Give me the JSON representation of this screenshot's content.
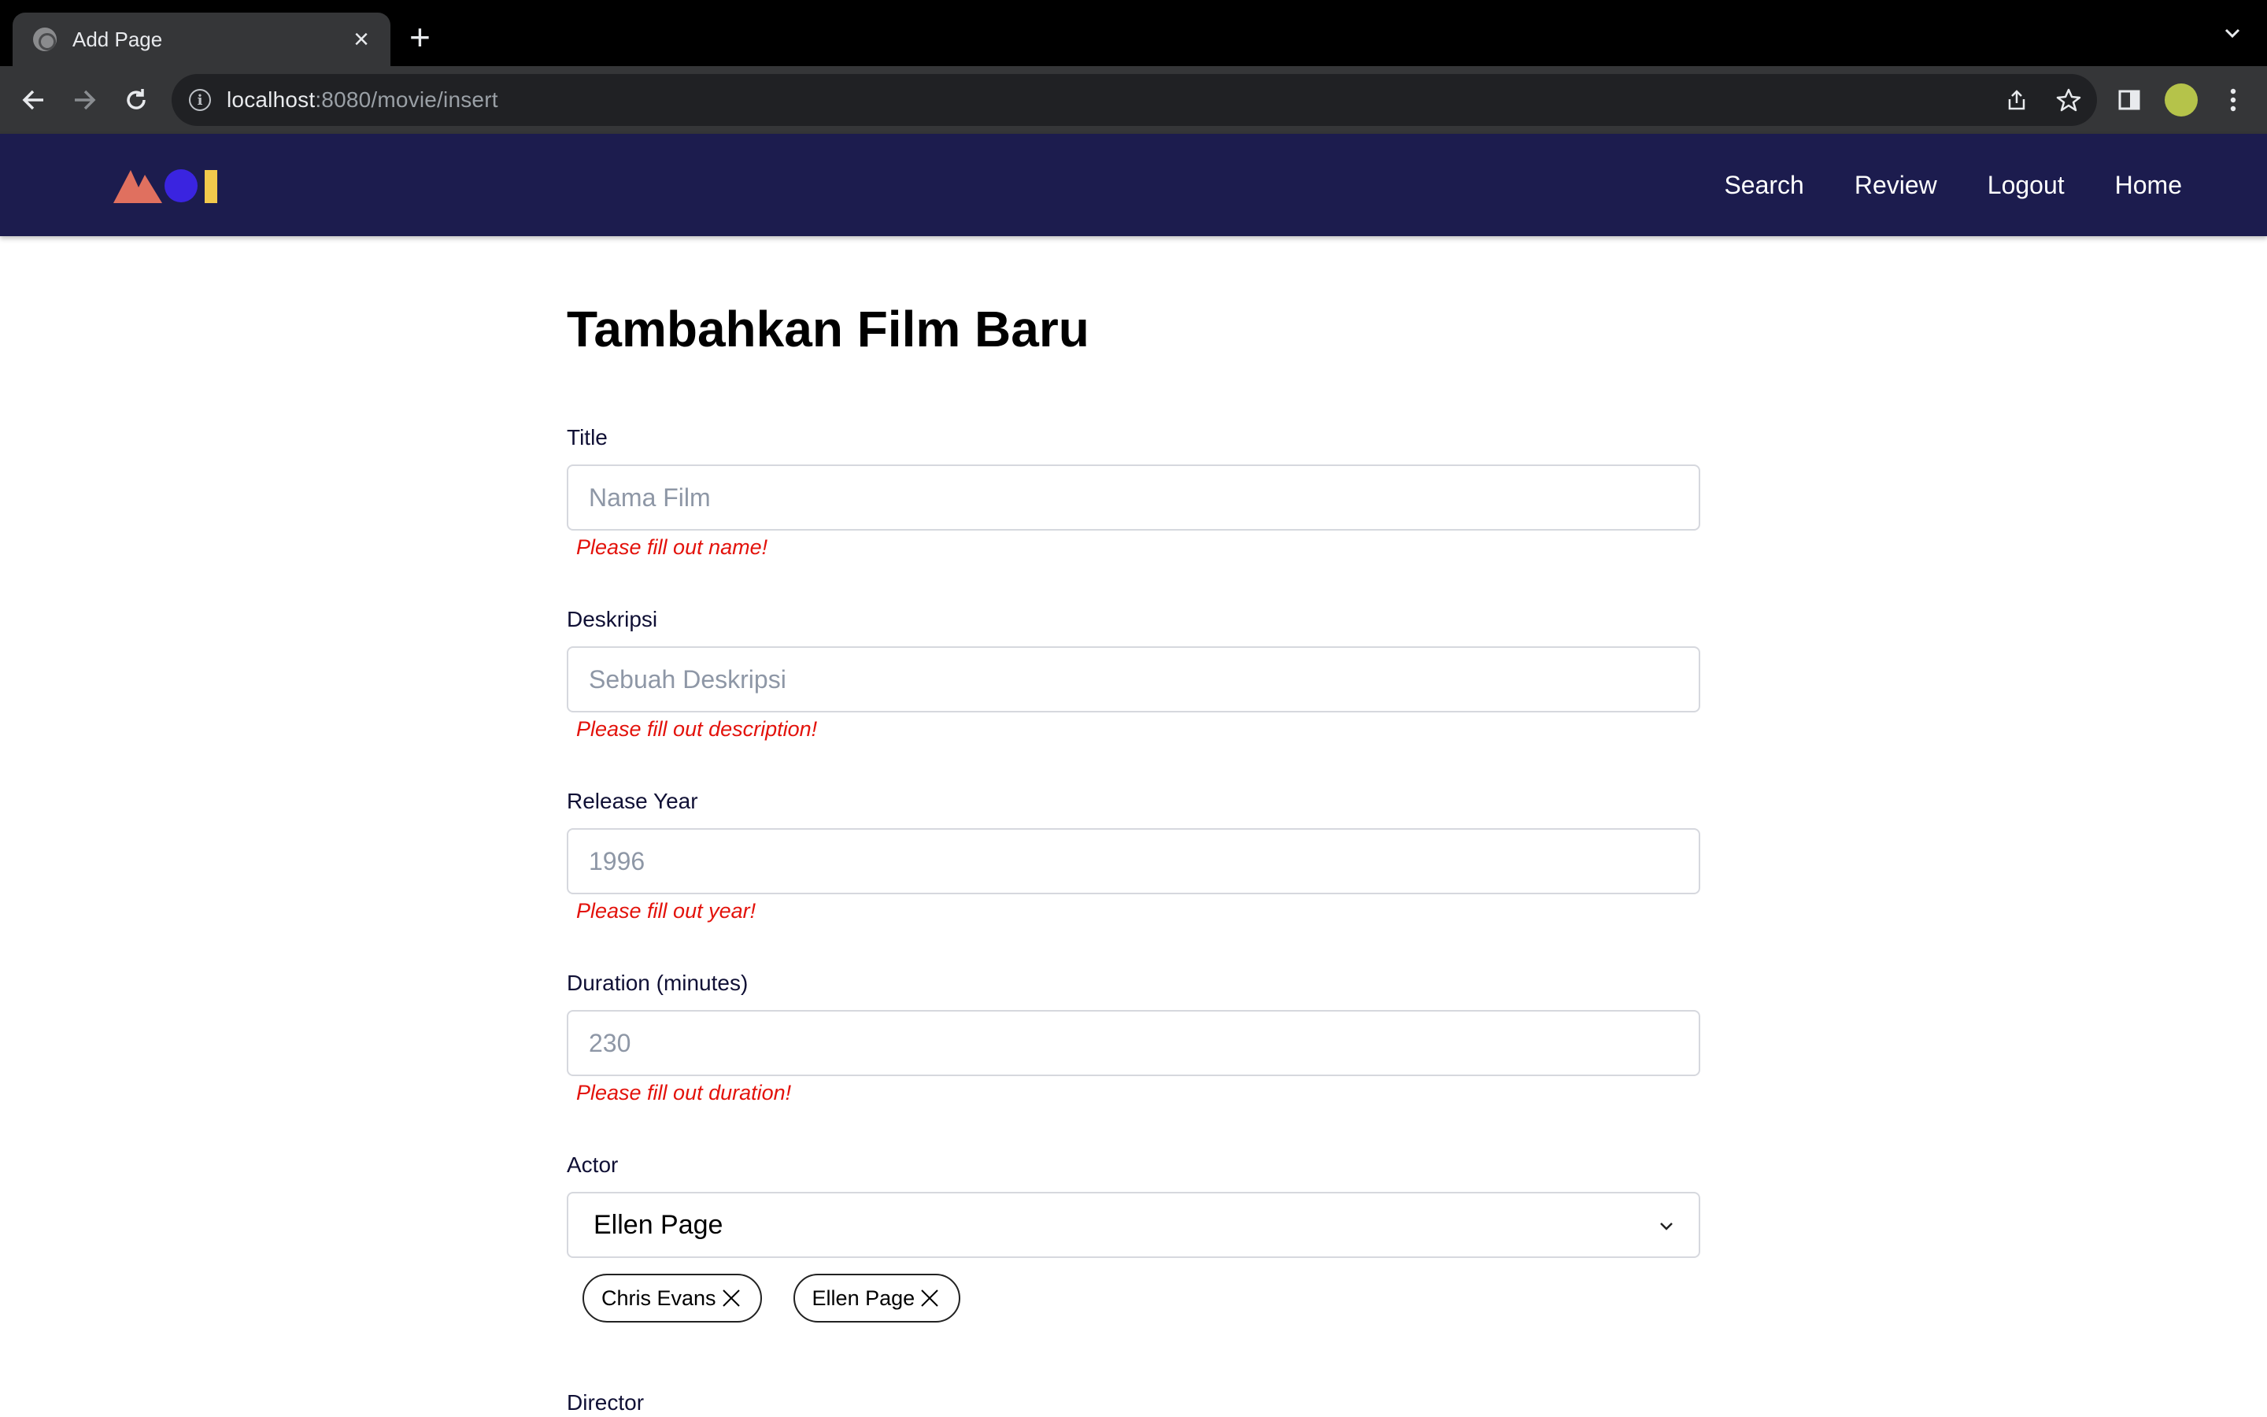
{
  "browser": {
    "tab_title": "Add Page",
    "url_host": "localhost",
    "url_rest": ":8080/movie/insert"
  },
  "nav": {
    "links": [
      "Search",
      "Review",
      "Logout",
      "Home"
    ]
  },
  "colors": {
    "nav_bg": "#1c1c4e",
    "error": "#e3120b",
    "logo_triangle": "#e0705f",
    "logo_circle": "#3a24e0",
    "logo_bar": "#f2c94c"
  },
  "form": {
    "heading": "Tambahkan Film Baru",
    "title": {
      "label": "Title",
      "placeholder": "Nama Film",
      "error": "Please fill out name!"
    },
    "description": {
      "label": "Deskripsi",
      "placeholder": "Sebuah Deskripsi",
      "error": "Please fill out description!"
    },
    "year": {
      "label": "Release Year",
      "placeholder": "1996",
      "error": "Please fill out year!"
    },
    "duration": {
      "label": "Duration (minutes)",
      "placeholder": "230",
      "error": "Please fill out duration!"
    },
    "actor": {
      "label": "Actor",
      "selected": "Ellen Page",
      "chips": [
        "Chris Evans",
        "Ellen Page"
      ]
    },
    "director": {
      "label": "Director"
    }
  }
}
